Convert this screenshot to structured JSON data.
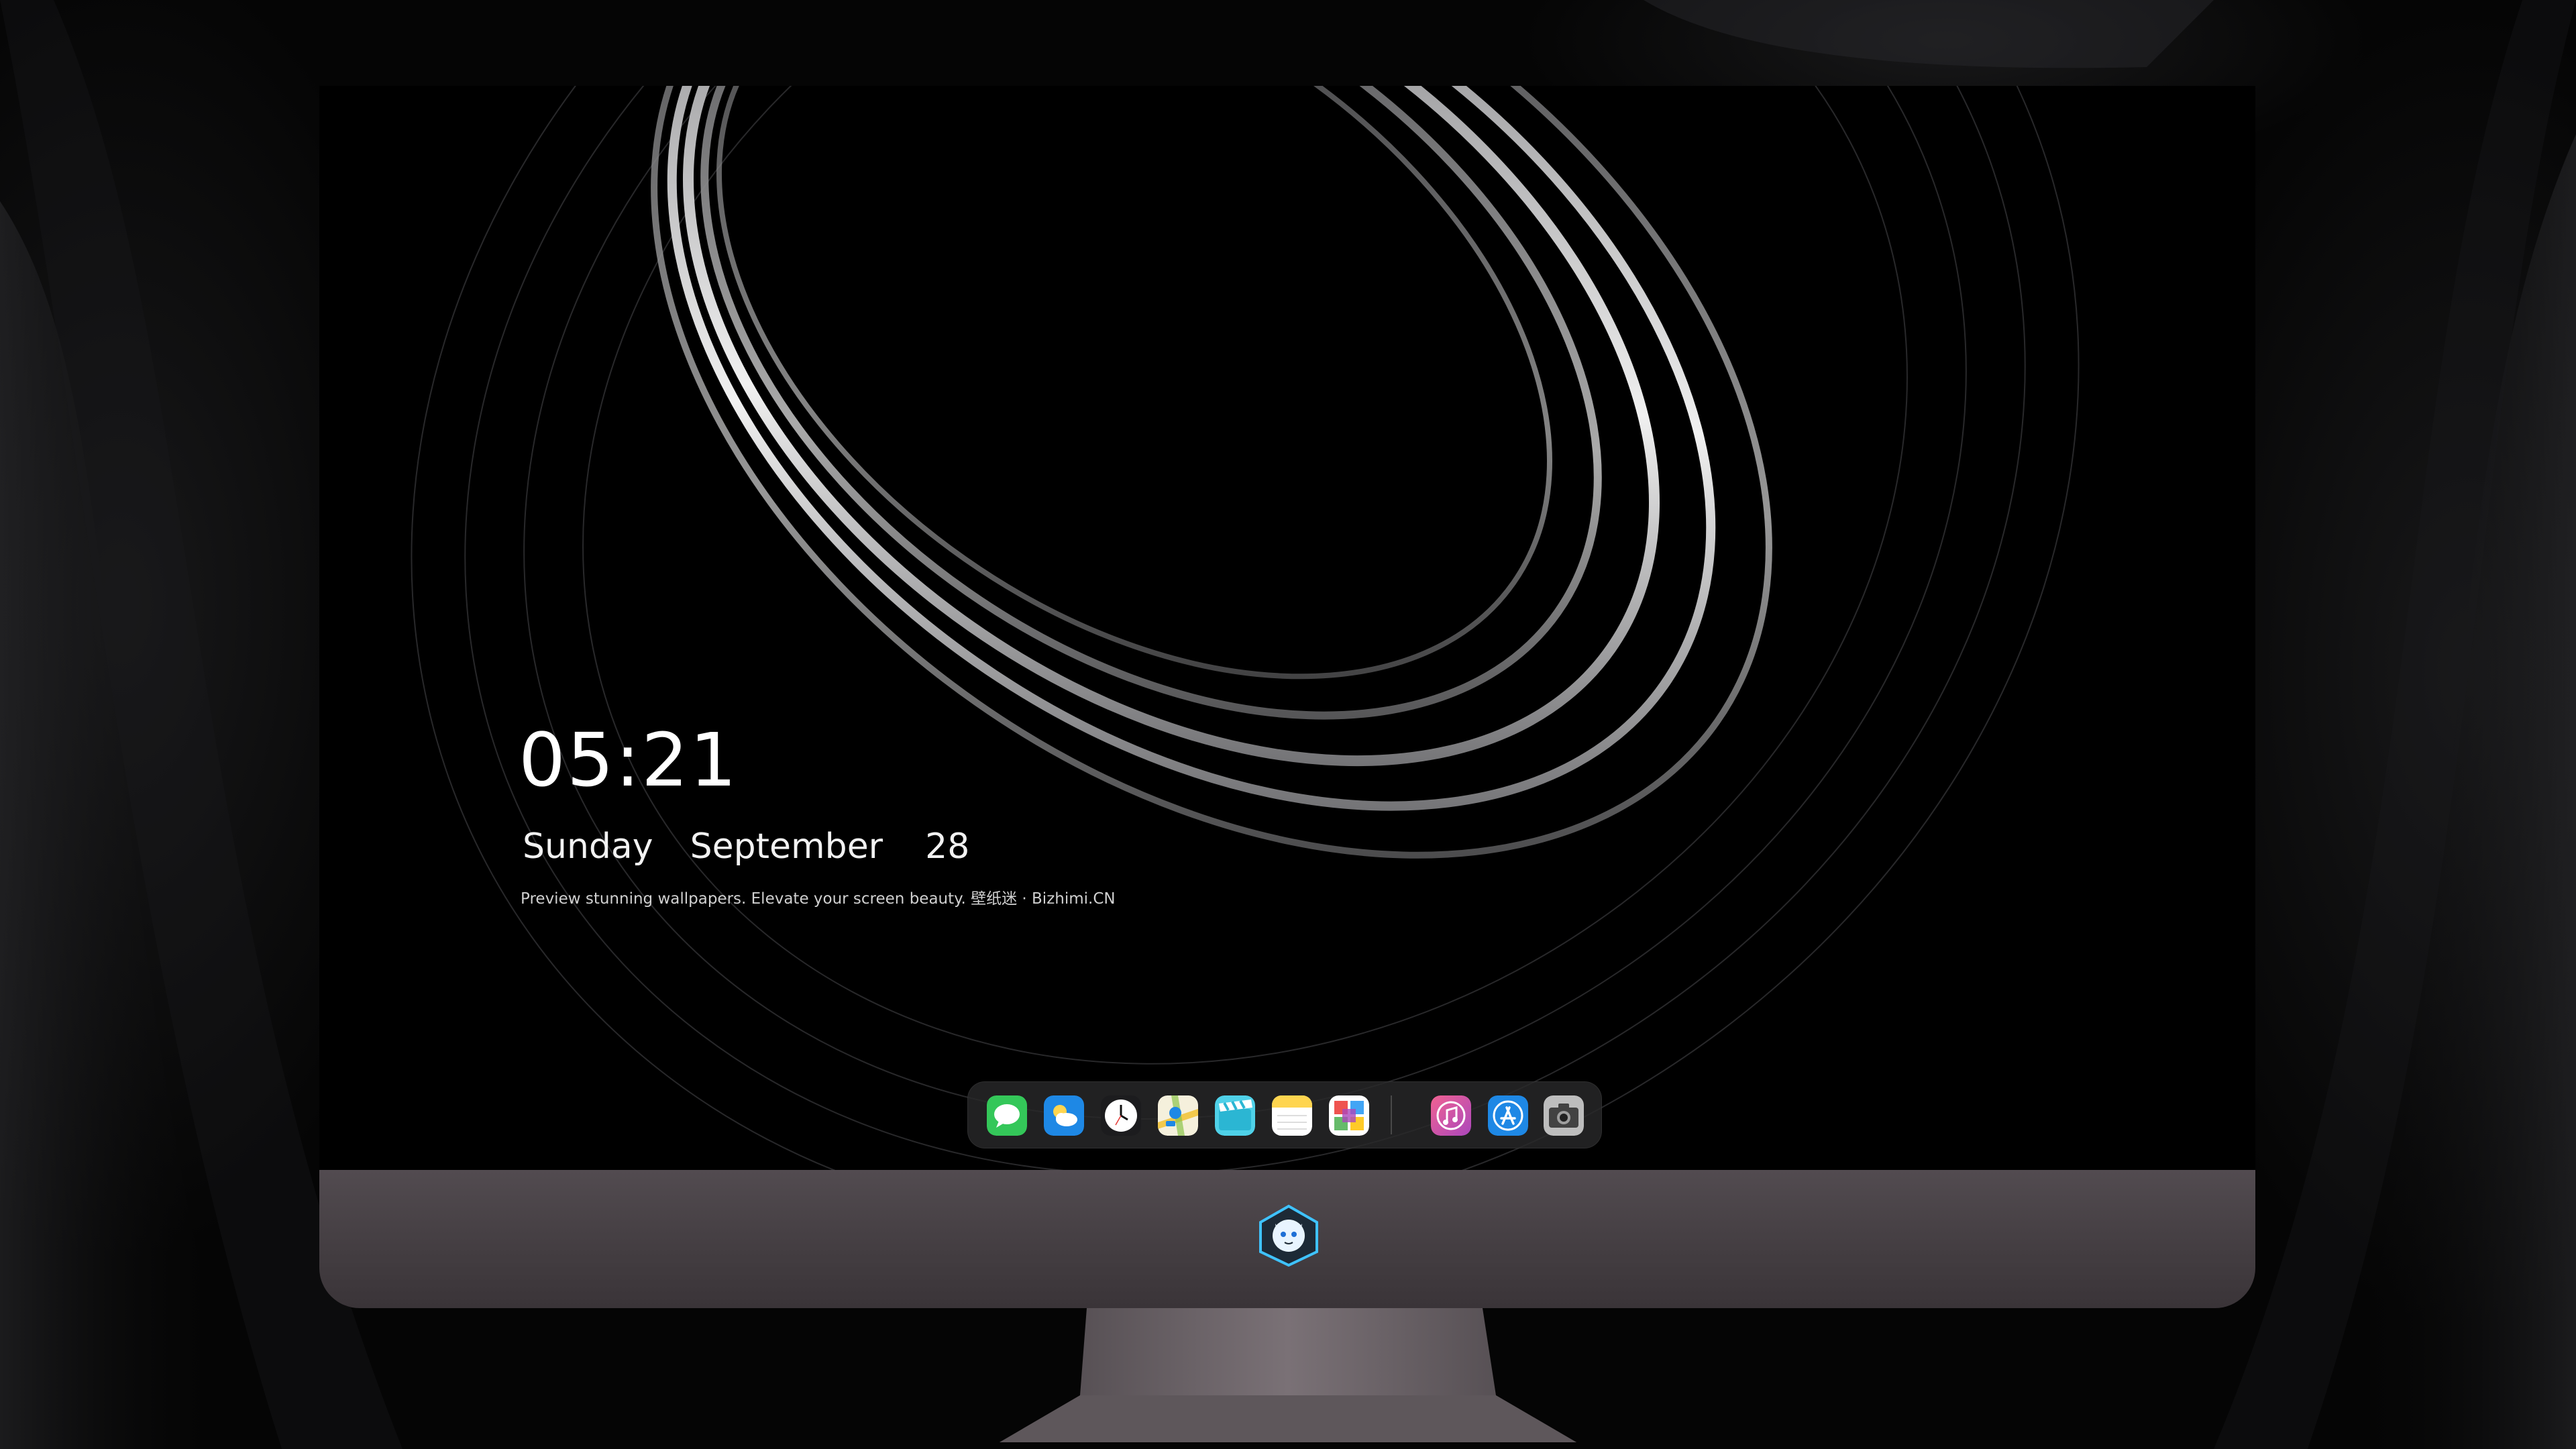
{
  "lock_screen": {
    "time": "05:21",
    "weekday": "Sunday",
    "month": "September",
    "day": "28",
    "tagline": "Preview stunning wallpapers. Elevate your screen beauty. 壁纸迷 · Bizhimi.CN"
  },
  "dock": {
    "apps": [
      {
        "name": "messages-icon",
        "color": "#34c759"
      },
      {
        "name": "weather-icon",
        "color": "#1e88e5"
      },
      {
        "name": "clock-icon",
        "color": "#ffffff"
      },
      {
        "name": "maps-icon",
        "color": "#f2c94c"
      },
      {
        "name": "clips-icon",
        "color": "#4fd1e8"
      },
      {
        "name": "notes-icon",
        "color": "#ffd54f"
      },
      {
        "name": "photo-grid-icon",
        "color": "#ffffff"
      },
      {
        "name": "itunes-icon",
        "color": "#e040fb"
      },
      {
        "name": "app-store-icon",
        "color": "#1e88e5"
      },
      {
        "name": "camera-icon",
        "color": "#9e9e9e"
      }
    ]
  },
  "colors": {
    "chin": "#4a4347",
    "dock_bg": "#28282a",
    "ring_highlight": "#e6e6e6"
  }
}
